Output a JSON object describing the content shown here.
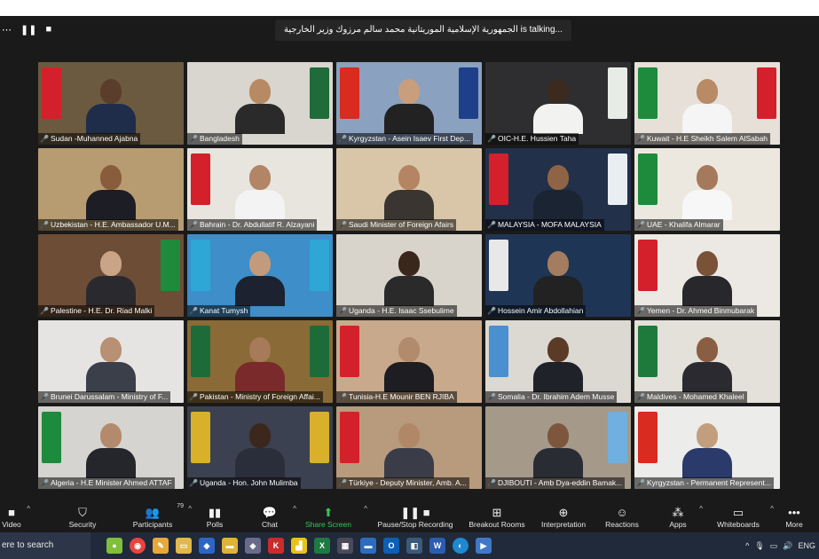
{
  "meeting": {
    "talking_text": "الجمهورية الإسلامية الموريتانية محمد سالم مرزوك وزير الخارجية is talking...",
    "participants_count": "79"
  },
  "tiles": [
    {
      "name": "Sudan -Muhanned Ajabna",
      "bg": "#6b5a3f",
      "suit": "#1f2d4a",
      "skin": "#5a3d2b",
      "flagL": "#d4202a",
      "flagR": ""
    },
    {
      "name": "Bangladesh",
      "bg": "#d9d6cf",
      "suit": "#2a2a2a",
      "skin": "#b78a64",
      "flagL": "",
      "flagR": "#1f6b3a"
    },
    {
      "name": "Kyrgyzstan - Asein Isaev First Dep...",
      "bg": "#8aa1c0",
      "suit": "#222",
      "skin": "#c99e7c",
      "flagL": "#d92b1f",
      "flagR": "#1e3f8a"
    },
    {
      "name": "OIC-H.E. Hussien Taha",
      "bg": "#2e2e30",
      "suit": "#f2f2f0",
      "skin": "#3b2a1f",
      "flagL": "",
      "flagR": "#e8ece6"
    },
    {
      "name": "Kuwait - H.E Sheikh Salem AlSabah",
      "bg": "#e6e0d8",
      "suit": "#f5f5f5",
      "skin": "#b98a66",
      "flagL": "#1e8a3c",
      "flagR": "#d4202a"
    },
    {
      "name": "Uzbekistan - H.E. Ambassador U.M...",
      "bg": "#b79c72",
      "suit": "#1d1d25",
      "skin": "#8a5c3e",
      "flagL": "",
      "flagR": ""
    },
    {
      "name": "Bahrain - Dr. Abdullatif R. Alzayani",
      "bg": "#e8e4de",
      "suit": "#f3f3f3",
      "skin": "#b18566",
      "flagL": "#d4202a",
      "flagR": ""
    },
    {
      "name": "Saudi Minister of Foreign Afairs",
      "bg": "#d9c6a8",
      "suit": "#3b3532",
      "skin": "#b48463",
      "flagL": "",
      "flagR": ""
    },
    {
      "name": "MALAYSIA - MOFA MALAYSIA",
      "bg": "#23304a",
      "suit": "#1b2433",
      "skin": "#8f6446",
      "flagL": "#d4202a",
      "flagR": "#e9eef2"
    },
    {
      "name": "UAE - Khalifa Almarar",
      "bg": "#ece8e0",
      "suit": "#f7f7f7",
      "skin": "#a57a5c",
      "flagL": "#1e8a3c",
      "flagR": ""
    },
    {
      "name": "Palestine - H.E. Dr. Riad Malki",
      "bg": "#6e4d37",
      "suit": "#2a2a2e",
      "skin": "#c9a487",
      "flagL": "",
      "flagR": "#1e8a3c"
    },
    {
      "name": "Kanat Tumysh",
      "bg": "#3d8ec9",
      "suit": "#1d2230",
      "skin": "#c29b7d",
      "flagL": "#2fa7d6",
      "flagR": "#2fa7d6"
    },
    {
      "name": "Uganda - H.E. Isaac Ssebulime",
      "bg": "#d9d4cb",
      "suit": "#2a2a2a",
      "skin": "#3a271c",
      "flagL": "",
      "flagR": ""
    },
    {
      "name": "Hossein Amir Abdollahian",
      "bg": "#1f3555",
      "suit": "#222",
      "skin": "#a47c60",
      "flagL": "#e8e8e8",
      "flagR": ""
    },
    {
      "name": "Yemen - Dr. Ahmed Binmubarak",
      "bg": "#ece9e4",
      "suit": "#27272c",
      "skin": "#7a5238",
      "flagL": "#d4202a",
      "flagR": ""
    },
    {
      "name": "Brunei Darussalam - Ministry of F...",
      "bg": "#e6e4e2",
      "suit": "#3b3f4a",
      "skin": "#b89073",
      "flagL": "",
      "flagR": ""
    },
    {
      "name": "Pakistan - Ministry of Foreign Affai...",
      "bg": "#8a6a36",
      "suit": "#7a2a2a",
      "skin": "#a77a5a",
      "flagL": "#1e6b3a",
      "flagR": "#1e6b3a"
    },
    {
      "name": "Tunisia-H.E Mounir BEN RJIBA",
      "bg": "#c9a98b",
      "suit": "#1d1d22",
      "skin": "#b28a6c",
      "flagL": "#d4202a",
      "flagR": ""
    },
    {
      "name": "Somalia - Dr. Ibrahim Adem Musse",
      "bg": "#dcd8d2",
      "suit": "#20222a",
      "skin": "#5a3b28",
      "flagL": "#4a8fd0",
      "flagR": ""
    },
    {
      "name": "Maldives - Mohamed Khaleel",
      "bg": "#e4e0da",
      "suit": "#2a2a30",
      "skin": "#8a5e42",
      "flagL": "#1e7a3a",
      "flagR": ""
    },
    {
      "name": "Algeria - H.E Minister Ahmed ATTAF",
      "bg": "#d6d4d0",
      "suit": "#24262c",
      "skin": "#b38a6c",
      "flagL": "#1e8a3c",
      "flagR": ""
    },
    {
      "name": "Uganda - Hon. John Mulimba",
      "bg": "#3b4150",
      "suit": "#2a2e3a",
      "skin": "#3b271c",
      "flagL": "#d9b02a",
      "flagR": "#d9b02a"
    },
    {
      "name": "Türkiye - Deputy Minister, Amb. A...",
      "bg": "#b89a7c",
      "suit": "#3a3d48",
      "skin": "#b08868",
      "flagL": "#d4202a",
      "flagR": ""
    },
    {
      "name": "DJIBOUTI - Amb Dya-eddin Bamak...",
      "bg": "#a59a8a",
      "suit": "#2a2c34",
      "skin": "#7d573d",
      "flagL": "",
      "flagR": "#6fb0e0"
    },
    {
      "name": "Kyrgyzstan - Permanent Represent...",
      "bg": "#ececea",
      "suit": "#2a3a6a",
      "skin": "#c29e7e",
      "flagL": "#d92b1f",
      "flagR": ""
    }
  ],
  "toolbar": {
    "video": "Video",
    "security": "Security",
    "participants": "Participants",
    "polls": "Polls",
    "chat": "Chat",
    "share_screen": "Share Screen",
    "recording": "Pause/Stop Recording",
    "breakout": "Breakout Rooms",
    "interpretation": "Interpretation",
    "reactions": "Reactions",
    "apps": "Apps",
    "whiteboards": "Whiteboards",
    "more": "More"
  },
  "taskbar": {
    "search_placeholder": "ere to search",
    "language": "ENG"
  },
  "icons": {
    "video": "video-icon",
    "security": "shield-icon",
    "participants": "people-icon",
    "polls": "bar-chart-icon",
    "chat": "chat-bubble-icon",
    "share_screen": "share-arrow-icon",
    "recording": "pause-stop-icon",
    "breakout": "grid-icon",
    "interpretation": "globe-icon",
    "reactions": "smile-plus-icon",
    "apps": "apps-icon",
    "whiteboards": "whiteboard-icon",
    "more": "ellipsis-icon"
  }
}
